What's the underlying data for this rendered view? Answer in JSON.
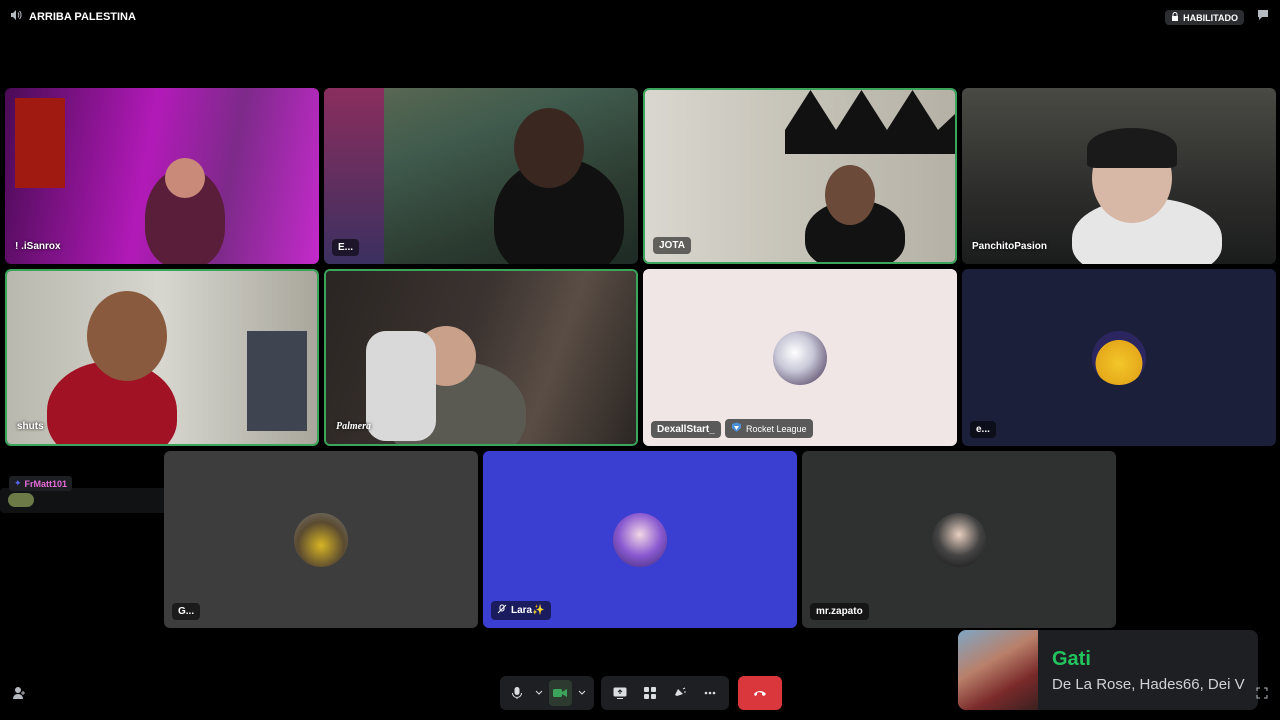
{
  "channel": {
    "name": "ARRIBA PALESTINA"
  },
  "topbar": {
    "status_badge": "HABILITADO"
  },
  "participants": [
    {
      "name": "! .iSanrox"
    },
    {
      "name": "E..."
    },
    {
      "name": "JOTA"
    },
    {
      "name": "PanchitoPasion"
    },
    {
      "name": "shuts"
    },
    {
      "name": "Palmera"
    },
    {
      "name": "DexallStart_",
      "activity": "Rocket League"
    },
    {
      "name": "e..."
    },
    {
      "name": "G..."
    },
    {
      "name": "Lara✨"
    },
    {
      "name": "mr.zapato"
    }
  ],
  "overlay_user": {
    "name": "FrMatt101"
  },
  "now_playing": {
    "title": "Gati",
    "artists": "De La Rose, Hades66, Dei V"
  },
  "colors": {
    "speaking": "#3ba55c",
    "hangup": "#da373c",
    "song_title": "#23c45e",
    "lara_bg": "#3b3fd1"
  },
  "icons": [
    "speaker-icon",
    "lock-icon",
    "chat-icon",
    "mic-icon",
    "chevron-down-icon",
    "camera-icon",
    "screen-share-icon",
    "activities-icon",
    "soundboard-icon",
    "more-icon",
    "hangup-icon",
    "add-user-icon",
    "fullscreen-icon",
    "rocket-league-icon"
  ]
}
